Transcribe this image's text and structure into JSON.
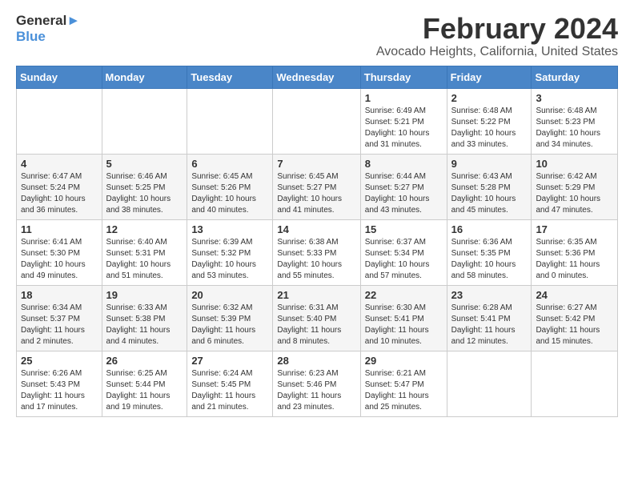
{
  "logo": {
    "line1": "General",
    "line2": "Blue"
  },
  "title": "February 2024",
  "location": "Avocado Heights, California, United States",
  "weekdays": [
    "Sunday",
    "Monday",
    "Tuesday",
    "Wednesday",
    "Thursday",
    "Friday",
    "Saturday"
  ],
  "weeks": [
    [
      {
        "day": "",
        "info": ""
      },
      {
        "day": "",
        "info": ""
      },
      {
        "day": "",
        "info": ""
      },
      {
        "day": "",
        "info": ""
      },
      {
        "day": "1",
        "info": "Sunrise: 6:49 AM\nSunset: 5:21 PM\nDaylight: 10 hours\nand 31 minutes."
      },
      {
        "day": "2",
        "info": "Sunrise: 6:48 AM\nSunset: 5:22 PM\nDaylight: 10 hours\nand 33 minutes."
      },
      {
        "day": "3",
        "info": "Sunrise: 6:48 AM\nSunset: 5:23 PM\nDaylight: 10 hours\nand 34 minutes."
      }
    ],
    [
      {
        "day": "4",
        "info": "Sunrise: 6:47 AM\nSunset: 5:24 PM\nDaylight: 10 hours\nand 36 minutes."
      },
      {
        "day": "5",
        "info": "Sunrise: 6:46 AM\nSunset: 5:25 PM\nDaylight: 10 hours\nand 38 minutes."
      },
      {
        "day": "6",
        "info": "Sunrise: 6:45 AM\nSunset: 5:26 PM\nDaylight: 10 hours\nand 40 minutes."
      },
      {
        "day": "7",
        "info": "Sunrise: 6:45 AM\nSunset: 5:27 PM\nDaylight: 10 hours\nand 41 minutes."
      },
      {
        "day": "8",
        "info": "Sunrise: 6:44 AM\nSunset: 5:27 PM\nDaylight: 10 hours\nand 43 minutes."
      },
      {
        "day": "9",
        "info": "Sunrise: 6:43 AM\nSunset: 5:28 PM\nDaylight: 10 hours\nand 45 minutes."
      },
      {
        "day": "10",
        "info": "Sunrise: 6:42 AM\nSunset: 5:29 PM\nDaylight: 10 hours\nand 47 minutes."
      }
    ],
    [
      {
        "day": "11",
        "info": "Sunrise: 6:41 AM\nSunset: 5:30 PM\nDaylight: 10 hours\nand 49 minutes."
      },
      {
        "day": "12",
        "info": "Sunrise: 6:40 AM\nSunset: 5:31 PM\nDaylight: 10 hours\nand 51 minutes."
      },
      {
        "day": "13",
        "info": "Sunrise: 6:39 AM\nSunset: 5:32 PM\nDaylight: 10 hours\nand 53 minutes."
      },
      {
        "day": "14",
        "info": "Sunrise: 6:38 AM\nSunset: 5:33 PM\nDaylight: 10 hours\nand 55 minutes."
      },
      {
        "day": "15",
        "info": "Sunrise: 6:37 AM\nSunset: 5:34 PM\nDaylight: 10 hours\nand 57 minutes."
      },
      {
        "day": "16",
        "info": "Sunrise: 6:36 AM\nSunset: 5:35 PM\nDaylight: 10 hours\nand 58 minutes."
      },
      {
        "day": "17",
        "info": "Sunrise: 6:35 AM\nSunset: 5:36 PM\nDaylight: 11 hours\nand 0 minutes."
      }
    ],
    [
      {
        "day": "18",
        "info": "Sunrise: 6:34 AM\nSunset: 5:37 PM\nDaylight: 11 hours\nand 2 minutes."
      },
      {
        "day": "19",
        "info": "Sunrise: 6:33 AM\nSunset: 5:38 PM\nDaylight: 11 hours\nand 4 minutes."
      },
      {
        "day": "20",
        "info": "Sunrise: 6:32 AM\nSunset: 5:39 PM\nDaylight: 11 hours\nand 6 minutes."
      },
      {
        "day": "21",
        "info": "Sunrise: 6:31 AM\nSunset: 5:40 PM\nDaylight: 11 hours\nand 8 minutes."
      },
      {
        "day": "22",
        "info": "Sunrise: 6:30 AM\nSunset: 5:41 PM\nDaylight: 11 hours\nand 10 minutes."
      },
      {
        "day": "23",
        "info": "Sunrise: 6:28 AM\nSunset: 5:41 PM\nDaylight: 11 hours\nand 12 minutes."
      },
      {
        "day": "24",
        "info": "Sunrise: 6:27 AM\nSunset: 5:42 PM\nDaylight: 11 hours\nand 15 minutes."
      }
    ],
    [
      {
        "day": "25",
        "info": "Sunrise: 6:26 AM\nSunset: 5:43 PM\nDaylight: 11 hours\nand 17 minutes."
      },
      {
        "day": "26",
        "info": "Sunrise: 6:25 AM\nSunset: 5:44 PM\nDaylight: 11 hours\nand 19 minutes."
      },
      {
        "day": "27",
        "info": "Sunrise: 6:24 AM\nSunset: 5:45 PM\nDaylight: 11 hours\nand 21 minutes."
      },
      {
        "day": "28",
        "info": "Sunrise: 6:23 AM\nSunset: 5:46 PM\nDaylight: 11 hours\nand 23 minutes."
      },
      {
        "day": "29",
        "info": "Sunrise: 6:21 AM\nSunset: 5:47 PM\nDaylight: 11 hours\nand 25 minutes."
      },
      {
        "day": "",
        "info": ""
      },
      {
        "day": "",
        "info": ""
      }
    ]
  ]
}
